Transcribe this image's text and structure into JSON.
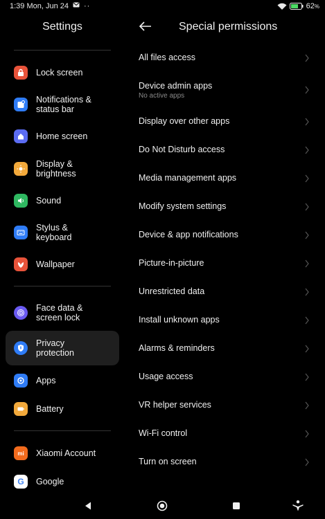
{
  "status": {
    "time_date": "1:39 Mon, Jun 24",
    "battery": "62"
  },
  "left": {
    "title": "Settings",
    "items": [
      {
        "label": "Lock screen",
        "icon": "lock-icon",
        "color": "#e8533a"
      },
      {
        "label": "Notifications &\nstatus bar",
        "icon": "notification-icon",
        "color": "#2f7cf6"
      },
      {
        "label": "Home screen",
        "icon": "home-icon",
        "color": "#5b6cf2"
      },
      {
        "label": "Display &\nbrightness",
        "icon": "brightness-icon",
        "color": "#f2a93b"
      },
      {
        "label": "Sound",
        "icon": "speaker-icon",
        "color": "#2fb861"
      },
      {
        "label": "Stylus &\nkeyboard",
        "icon": "keyboard-icon",
        "color": "#2f7cf6"
      },
      {
        "label": "Wallpaper",
        "icon": "wallpaper-icon",
        "color": "#e8533a"
      },
      {
        "label": "Face data &\nscreen lock",
        "icon": "fingerprint-icon",
        "color": "#6a5af2"
      },
      {
        "label": "Privacy\nprotection",
        "icon": "shield-icon",
        "color": "#2f7cf6"
      },
      {
        "label": "Apps",
        "icon": "apps-icon",
        "color": "#2f7cf6"
      },
      {
        "label": "Battery",
        "icon": "battery-icon",
        "color": "#f2a93b"
      },
      {
        "label": "Xiaomi Account",
        "icon": "mi-icon",
        "color": "#f26b1d"
      },
      {
        "label": "Google",
        "icon": "google-icon",
        "color": "#ffffff"
      }
    ]
  },
  "right": {
    "title": "Special permissions",
    "items": [
      {
        "label": "All files access"
      },
      {
        "label": "Device admin apps",
        "sub": "No active apps"
      },
      {
        "label": "Display over other apps"
      },
      {
        "label": "Do Not Disturb access"
      },
      {
        "label": "Media management apps"
      },
      {
        "label": "Modify system settings"
      },
      {
        "label": "Device & app notifications"
      },
      {
        "label": "Picture-in-picture"
      },
      {
        "label": "Unrestricted data"
      },
      {
        "label": "Install unknown apps"
      },
      {
        "label": "Alarms & reminders"
      },
      {
        "label": "Usage access"
      },
      {
        "label": "VR helper services"
      },
      {
        "label": "Wi-Fi control"
      },
      {
        "label": "Turn on screen"
      }
    ]
  },
  "nav": {
    "icons": [
      "back-icon",
      "home-icon",
      "recents-icon",
      "accessibility-icon"
    ]
  }
}
